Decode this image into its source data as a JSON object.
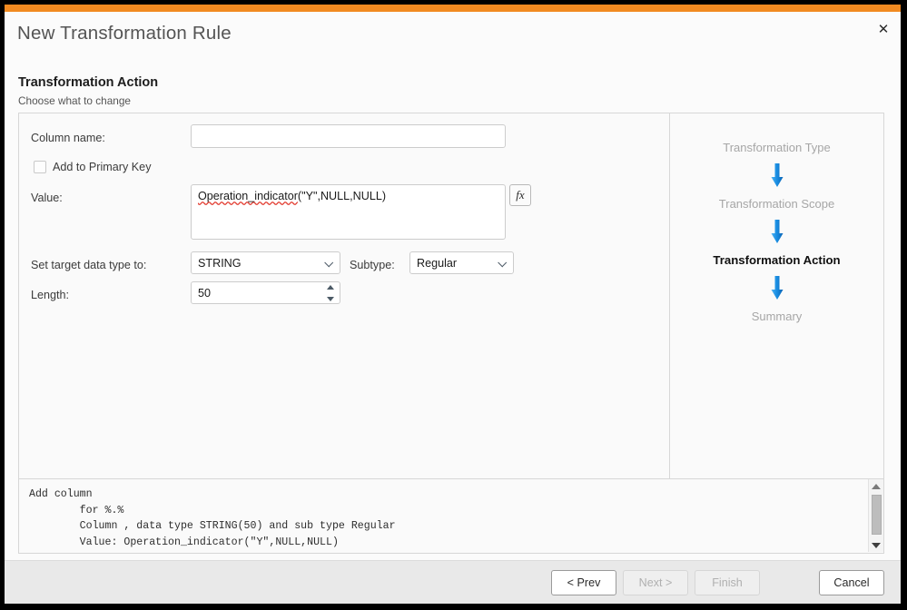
{
  "window": {
    "title": "New Transformation Rule",
    "close_icon": "close-icon",
    "accent_color": "#f18a21"
  },
  "header": {
    "section_title": "Transformation Action",
    "section_subtitle": "Choose what to change"
  },
  "form": {
    "column_name": {
      "label": "Column name:",
      "value": "",
      "placeholder": ""
    },
    "primary_key": {
      "label": "Add to Primary Key",
      "checked": false
    },
    "value_field": {
      "label": "Value:",
      "value_prefix": "Operation_indicator",
      "value_suffix": "(\"Y\",NULL,NULL)",
      "full_value": "Operation_indicator(\"Y\",NULL,NULL)",
      "fx_button_label": "fx"
    },
    "data_type": {
      "label": "Set target data type to:",
      "value": "STRING",
      "chevron_icon": "chevron-down-icon"
    },
    "subtype": {
      "label": "Subtype:",
      "value": "Regular",
      "chevron_icon": "chevron-down-icon"
    },
    "length": {
      "label": "Length:",
      "value": "50",
      "stepper_icon": "spinner-arrows-icon"
    }
  },
  "stepper": {
    "arrow_icon": "arrow-down-icon",
    "arrow_color": "#1a8fe3",
    "steps": [
      {
        "label": "Transformation Type",
        "state": "done"
      },
      {
        "label": "Transformation Scope",
        "state": "done"
      },
      {
        "label": "Transformation Action",
        "state": "active"
      },
      {
        "label": "Summary",
        "state": "pending"
      }
    ]
  },
  "log": {
    "lines": [
      "Add column",
      "        for %.%",
      "        Column , data type STRING(50) and sub type Regular",
      "        Value: Operation_indicator(\"Y\",NULL,NULL)"
    ],
    "text": "Add column\n        for %.%\n        Column , data type STRING(50) and sub type Regular\n        Value: Operation_indicator(\"Y\",NULL,NULL)",
    "scrollbar": {
      "up_icon": "triangle-up-icon",
      "down_icon": "triangle-down-icon"
    }
  },
  "footer": {
    "prev": {
      "label": "< Prev",
      "enabled": true
    },
    "next": {
      "label": "Next >",
      "enabled": false
    },
    "finish": {
      "label": "Finish",
      "enabled": false
    },
    "cancel": {
      "label": "Cancel",
      "enabled": true
    }
  }
}
